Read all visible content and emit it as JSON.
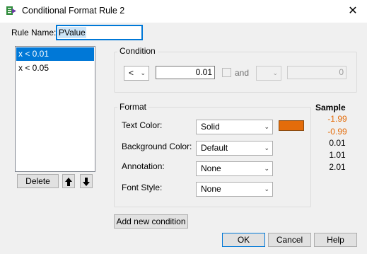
{
  "window": {
    "title": "Conditional Format Rule 2",
    "close_glyph": "✕"
  },
  "rule_name": {
    "label": "Rule Name:",
    "value": "PValue"
  },
  "rules": {
    "items": [
      "x < 0.01",
      "x < 0.05"
    ],
    "selected_index": 0
  },
  "list_buttons": {
    "delete": "Delete",
    "up_icon": "arrow-up-icon",
    "down_icon": "arrow-down-icon"
  },
  "condition": {
    "legend": "Condition",
    "operator": "<",
    "value": "0.01",
    "and_label": "and",
    "and_checked": false,
    "second_value": "0"
  },
  "format": {
    "legend": "Format",
    "text_color": {
      "label": "Text Color:",
      "value": "Solid",
      "swatch": "#e46c0a"
    },
    "background_color": {
      "label": "Background Color:",
      "value": "Default"
    },
    "annotation": {
      "label": "Annotation:",
      "value": "None"
    },
    "font_style": {
      "label": "Font Style:",
      "value": "None"
    }
  },
  "sample": {
    "title": "Sample",
    "values": [
      {
        "text": "-1.99",
        "color": "#e46c0a"
      },
      {
        "text": "-0.99",
        "color": "#e46c0a"
      },
      {
        "text": "0.01",
        "color": "#000000"
      },
      {
        "text": "1.01",
        "color": "#000000"
      },
      {
        "text": "2.01",
        "color": "#000000"
      }
    ]
  },
  "buttons": {
    "add_condition": "Add new condition",
    "ok": "OK",
    "cancel": "Cancel",
    "help": "Help"
  }
}
